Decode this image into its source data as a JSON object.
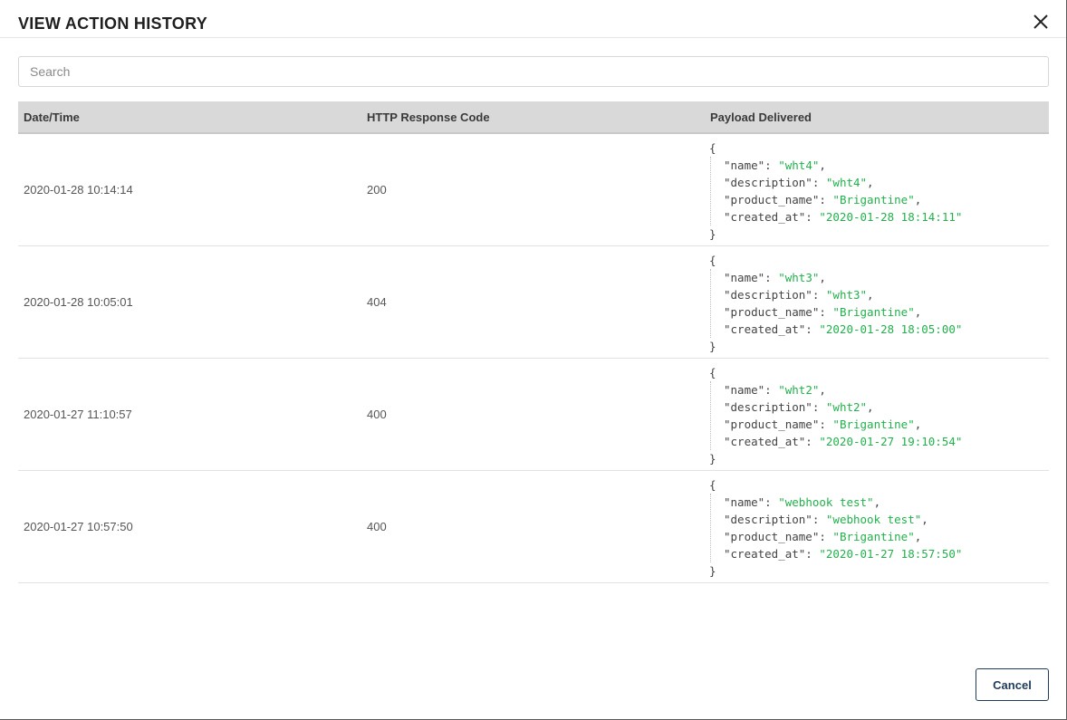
{
  "modal": {
    "title": "VIEW ACTION HISTORY",
    "close_icon": "close-icon"
  },
  "search": {
    "placeholder": "Search",
    "value": ""
  },
  "table": {
    "columns": [
      "Date/Time",
      "HTTP Response Code",
      "Payload Delivered"
    ],
    "rows": [
      {
        "datetime": "2020-01-28 10:14:14",
        "code": "200",
        "payload": {
          "open": "{",
          "close": "}",
          "lines": [
            {
              "key": "\"name\": ",
              "value": "\"wht4\"",
              "comma": ","
            },
            {
              "key": "\"description\": ",
              "value": "\"wht4\"",
              "comma": ","
            },
            {
              "key": "\"product_name\": ",
              "value": "\"Brigantine\"",
              "comma": ","
            },
            {
              "key": "\"created_at\": ",
              "value": "\"2020-01-28 18:14:11\"",
              "comma": ""
            }
          ]
        }
      },
      {
        "datetime": "2020-01-28 10:05:01",
        "code": "404",
        "payload": {
          "open": "{",
          "close": "}",
          "lines": [
            {
              "key": "\"name\": ",
              "value": "\"wht3\"",
              "comma": ","
            },
            {
              "key": "\"description\": ",
              "value": "\"wht3\"",
              "comma": ","
            },
            {
              "key": "\"product_name\": ",
              "value": "\"Brigantine\"",
              "comma": ","
            },
            {
              "key": "\"created_at\": ",
              "value": "\"2020-01-28 18:05:00\"",
              "comma": ""
            }
          ]
        }
      },
      {
        "datetime": "2020-01-27 11:10:57",
        "code": "400",
        "payload": {
          "open": "{",
          "close": "}",
          "lines": [
            {
              "key": "\"name\": ",
              "value": "\"wht2\"",
              "comma": ","
            },
            {
              "key": "\"description\": ",
              "value": "\"wht2\"",
              "comma": ","
            },
            {
              "key": "\"product_name\": ",
              "value": "\"Brigantine\"",
              "comma": ","
            },
            {
              "key": "\"created_at\": ",
              "value": "\"2020-01-27 19:10:54\"",
              "comma": ""
            }
          ]
        }
      },
      {
        "datetime": "2020-01-27 10:57:50",
        "code": "400",
        "payload": {
          "open": "{",
          "close": "}",
          "lines": [
            {
              "key": "\"name\": ",
              "value": "\"webhook test\"",
              "comma": ","
            },
            {
              "key": "\"description\": ",
              "value": "\"webhook test\"",
              "comma": ","
            },
            {
              "key": "\"product_name\": ",
              "value": "\"Brigantine\"",
              "comma": ","
            },
            {
              "key": "\"created_at\": ",
              "value": "\"2020-01-27 18:57:50\"",
              "comma": ""
            }
          ]
        }
      }
    ]
  },
  "footer": {
    "cancel_label": "Cancel"
  },
  "colors": {
    "json_string": "#22b14c",
    "header_bg": "#d9d9d9",
    "cancel_border": "#1f3a5a"
  }
}
